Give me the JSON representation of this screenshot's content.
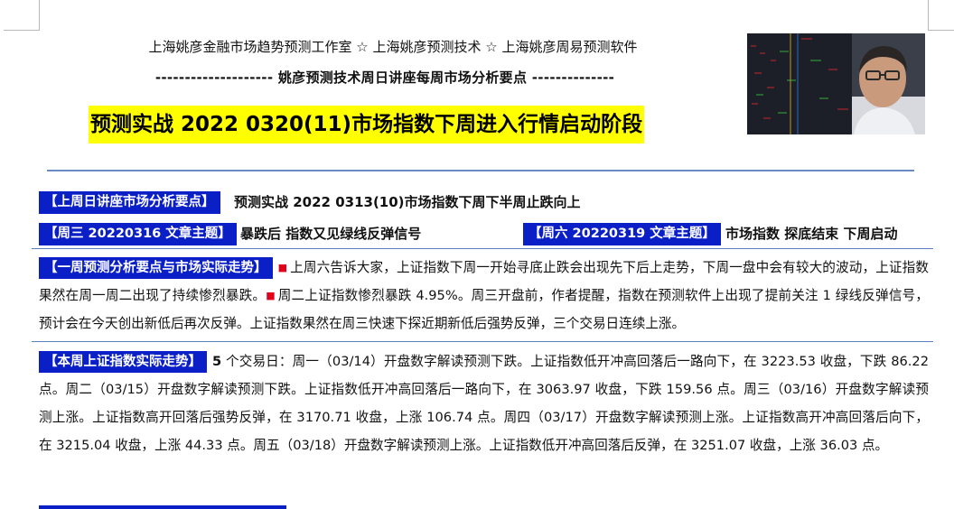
{
  "header": {
    "studio_line": "上海姚彦金融市场趋势预测工作室 ☆ 上海姚彦预测技术 ☆ 上海姚彦周易预测软件",
    "subtitle_line": "--------------------  姚彦预测技术周日讲座每周市场分析要点   --------------",
    "main_title": "预测实战 2022 0320(11)市场指数下周进入行情启动阶段"
  },
  "last_week": {
    "label": "【上周日讲座市场分析要点】",
    "text": "预测实战 2022 0313(10)市场指数下周下半周止跌向上"
  },
  "wed_topic": {
    "label": "【周三 20220316 文章主题】",
    "text": "暴跌后  指数又见绿线反弹信号"
  },
  "sat_topic": {
    "label": "【周六 20220319 文章主题】",
    "text": "市场指数  探底结束  下周启动"
  },
  "analysis": {
    "label": "【一周预测分析要点与市场实际走势】",
    "bullet": "■",
    "part1": "上周六告诉大家，上证指数下周一开始寻底止跌会出现先下后上走势，下周一盘中会有较大的波动，上证指数果然在周一周二出现了持续惨烈暴跌。",
    "part2": "周二上证指数惨烈暴跌 4.95%。周三开盘前，作者提醒，指数在预测软件上出现了提前关注 1 绿线反弹信号，预计会在今天创出新低后再次反弹。上证指数果然在周三快速下探近期新低后强势反弹，三个交易日连续上涨。"
  },
  "actual": {
    "label": "【本周上证指数实际走势】",
    "lead": "5",
    "text": " 个交易日：周一（03/14）开盘数字解读预测下跌。上证指数低开冲高回落后一路向下，在 3223.53 收盘，下跌 86.22 点。周二（03/15）开盘数字解读预测下跌。上证指数低开冲高回落后一路向下，在 3063.97 收盘，下跌 159.56 点。周三（03/16）开盘数字解读预测上涨。上证指数高开回落后强势反弹，在 3170.71 收盘，上涨 106.74 点。周四（03/17）开盘数字解读预测上涨。上证指数高开冲高回落后向下，在 3215.04 收盘，上涨 44.33 点。周五（03/18）开盘数字解读预测上涨。上证指数低开冲高回落后反弹，在 3251.07 收盘，上涨 36.03 点。"
  },
  "colors": {
    "label_bg": "#0b1fc6",
    "title_highlight": "#ffff00",
    "bullet": "#e0001b",
    "rule": "#6a8cc4"
  }
}
